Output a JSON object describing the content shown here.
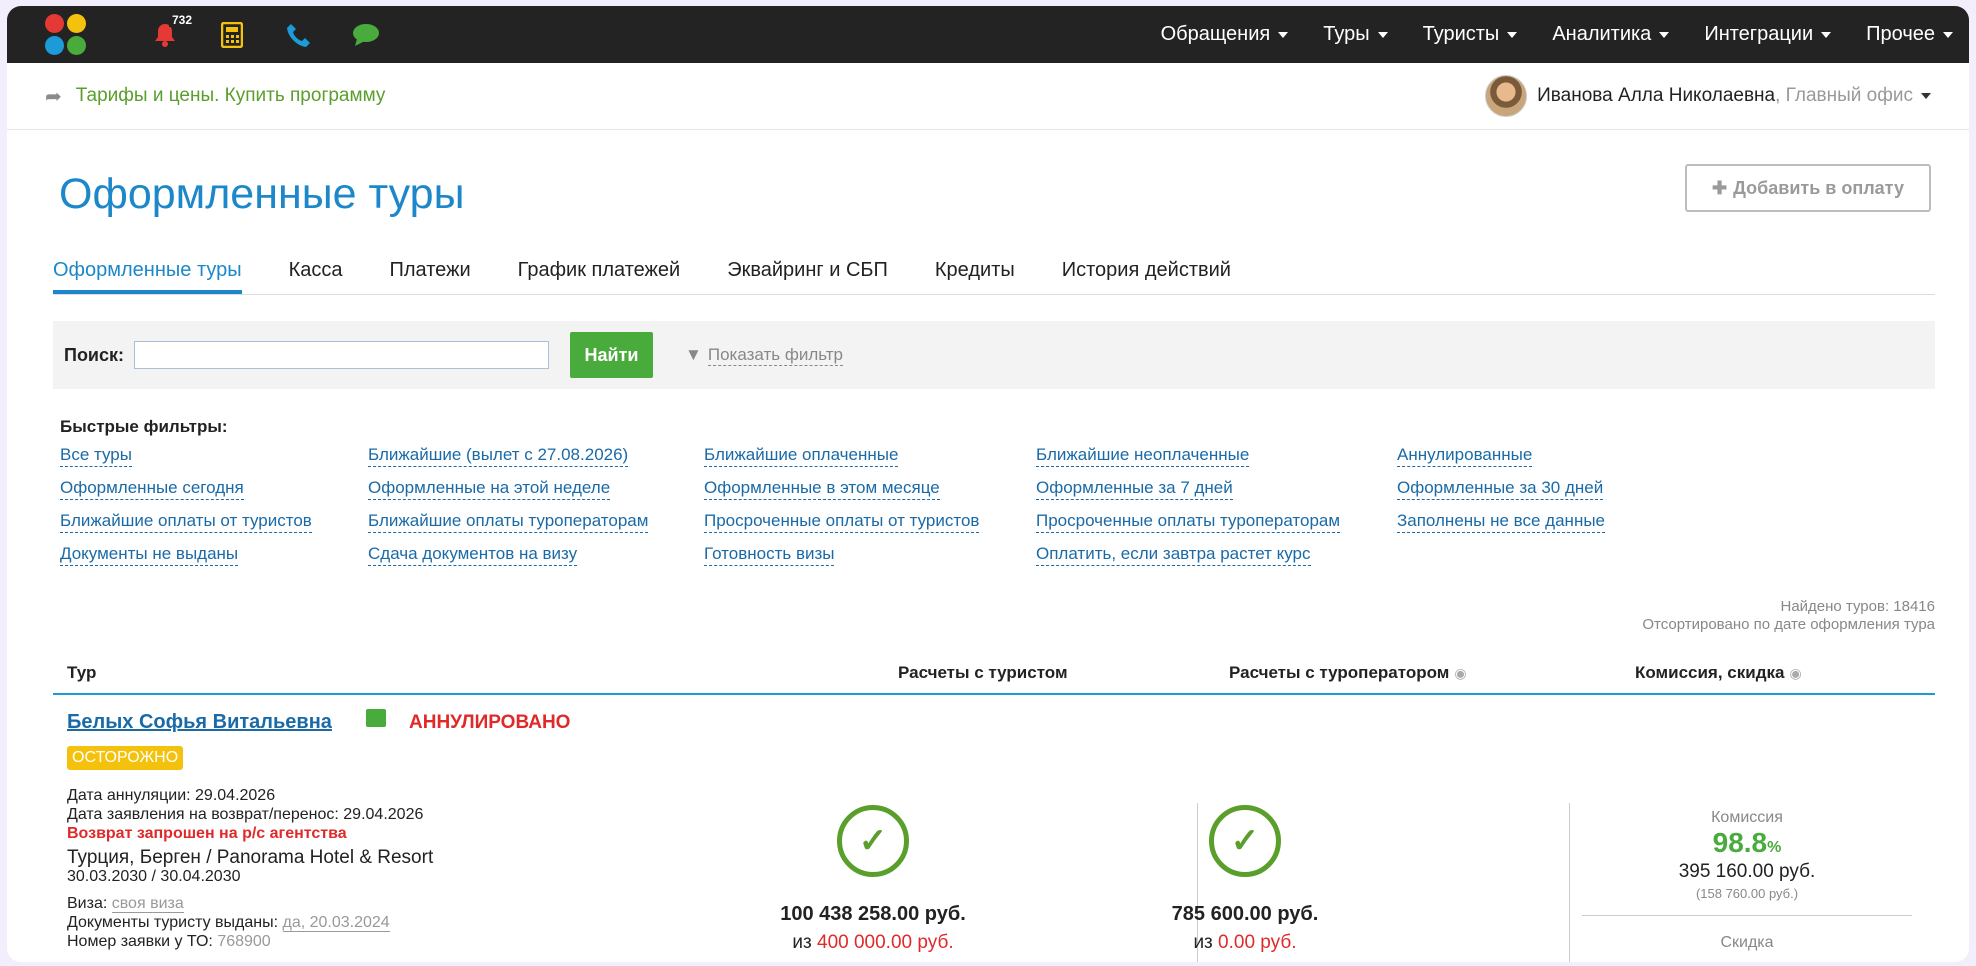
{
  "topbar": {
    "notifications_count": "732",
    "menu": [
      "Обращения",
      "Туры",
      "Туристы",
      "Аналитика",
      "Интеграции",
      "Прочее"
    ],
    "icons": [
      "app-logo-icon",
      "bell-icon",
      "calculator-icon",
      "phone-icon",
      "chat-icon"
    ],
    "colors": {
      "bg": "#232323",
      "bell": "#e53935",
      "calculator": "#f4c20d",
      "phone": "#1c9bd8",
      "chat": "#4aab3d"
    }
  },
  "subbar": {
    "tariff_link": "Тарифы и цены. Купить программу",
    "user_name": "Иванова Алла Николаевна",
    "user_office": ", Главный офис"
  },
  "page": {
    "title": "Оформленные туры",
    "add_button": "Добавить в оплату",
    "tabs": [
      "Оформленные туры",
      "Касса",
      "Платежи",
      "График платежей",
      "Эквайринг и СБП",
      "Кредиты",
      "История действий"
    ],
    "active_tab": "Оформленные туры"
  },
  "search": {
    "label": "Поиск:",
    "value": "",
    "button": "Найти",
    "filter_link": "Показать фильтр"
  },
  "quick_filters": {
    "title": "Быстрые фильтры:",
    "items": [
      "Все туры",
      "Ближайшие (вылет с 27.08.2026)",
      "Ближайшие оплаченные",
      "Ближайшие неоплаченные",
      "Аннулированные",
      "Оформленные сегодня",
      "Оформленные на этой неделе",
      "Оформленные в этом месяце",
      "Оформленные за 7 дней",
      "Оформленные за 30 дней",
      "Ближайшие оплаты от туристов",
      "Ближайшие оплаты туроператорам",
      "Просроченные оплаты от туристов",
      "Просроченные оплаты туроператорам",
      "Заполнены не все данные",
      "Документы не выданы",
      "Сдача документов на визу",
      "Готовность визы",
      "Оплатить, если завтра растет курс"
    ]
  },
  "results": {
    "found": "Найдено туров: 18416",
    "sorted": "Отсортировано по дате оформления тура"
  },
  "table": {
    "headers": {
      "tour": "Тур",
      "tourist": "Расчеты с туристом",
      "operator": "Расчеты с туроператором",
      "commission": "Комиссия, скидка"
    }
  },
  "tour": {
    "name": "Белых Софья Витальевна",
    "status": "АННУЛИРОВАНО",
    "warning": "ОСТОРОЖНО",
    "annul_date": "Дата аннуляции: 29.04.2026",
    "refund_date": "Дата заявления на возврат/перенос: 29.04.2026",
    "refund_note": "Возврат запрошен на р/с агентства",
    "destination": "Турция, Берген / Panorama Hotel & Resort",
    "dates": "30.03.2030 / 30.04.2030",
    "visa_label": "Виза: ",
    "visa_value": "своя виза",
    "docs_label": "Документы туристу выданы: ",
    "docs_value": "да, 20.03.2024",
    "request_label": "Номер заявки у ТО: ",
    "request_value": "768900",
    "tourist_amount": "100 438 258.00 руб.",
    "tourist_of_prefix": "из ",
    "tourist_of": "400 000.00 руб.",
    "operator_amount": "785 600.00 руб.",
    "operator_of_prefix": "из ",
    "operator_of": "0.00 руб.",
    "commission_label": "Комиссия",
    "commission_pct": "98.8",
    "commission_pct_sign": "%",
    "commission_sum": "395 160.00 руб.",
    "commission_sub": "(158 760.00 руб.)",
    "discount_label": "Скидка"
  }
}
